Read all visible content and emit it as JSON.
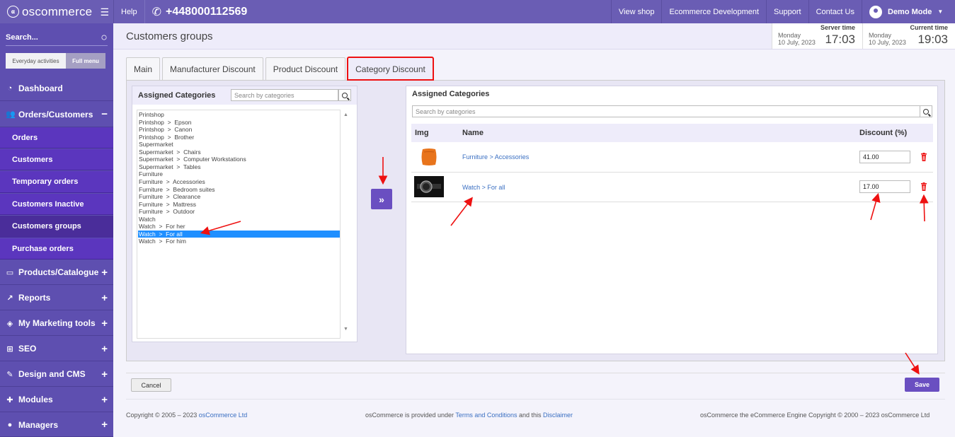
{
  "topbar": {
    "logo_text": "oscommerce",
    "logo_mark": "⍺",
    "menu_icon": "hamburger-icon",
    "help_label": "Help",
    "phone": "+448000112569",
    "links": [
      "View shop",
      "Ecommerce Development",
      "Support",
      "Contact Us"
    ],
    "user_label": "Demo Mode"
  },
  "sidebar": {
    "search_placeholder": "Search...",
    "mode_everyday": "Everyday activities",
    "mode_full": "Full menu",
    "dashboard": "Dashboard",
    "orders_customers": "Orders/Customers",
    "subitems": [
      "Orders",
      "Customers",
      "Temporary orders",
      "Customers Inactive",
      "Customers groups",
      "Purchase orders"
    ],
    "sections": [
      "Products/Catalogue",
      "Reports",
      "My Marketing tools",
      "SEO",
      "Design and CMS",
      "Modules",
      "Managers"
    ]
  },
  "header": {
    "page_title": "Customers groups",
    "server_time_label": "Server time",
    "server_day": "Monday",
    "server_date": "10 July, 2023",
    "server_clock": "17:03",
    "current_time_label": "Current time",
    "current_day": "Monday",
    "current_date": "10 July, 2023",
    "current_clock": "19:03"
  },
  "tabs": [
    "Main",
    "Manufacturer Discount",
    "Product Discount",
    "Category Discount"
  ],
  "left_panel": {
    "title": "Assigned Categories",
    "search_placeholder": "Search by categories",
    "categories": [
      "Printshop",
      "Printshop  >  Epson",
      "Printshop  >  Canon",
      "Printshop  >  Brother",
      "Supermarket",
      "Supermarket  >  Chairs",
      "Supermarket  >  Computer Workstations",
      "Supermarket  >  Tables",
      "Furniture",
      "Furniture  >  Accessories",
      "Furniture  >  Bedroom suites",
      "Furniture  >  Clearance",
      "Furniture  >  Mattress",
      "Furniture  >  Outdoor",
      "Watch",
      "Watch  >  For her",
      "Watch  >  For all",
      "Watch  >  For him"
    ],
    "selected_index": 16
  },
  "move_button_glyph": "»",
  "right_panel": {
    "title": "Assigned Categories",
    "search_placeholder": "Search by categories",
    "columns": [
      "Img",
      "Name",
      "Discount (%)"
    ],
    "rows": [
      {
        "name": "Furniture > Accessories",
        "discount": "41.00"
      },
      {
        "name": "Watch > For all",
        "discount": "17.00"
      }
    ]
  },
  "actions": {
    "cancel_label": "Cancel",
    "save_label": "Save"
  },
  "footer": {
    "copyright_prefix": "Copyright © 2005 – 2023 ",
    "copyright_link": "osCommerce Ltd",
    "provided_prefix": "osCommerce is provided under ",
    "terms_link": "Terms and Conditions",
    "provided_mid": " and this ",
    "disclaimer_link": "Disclaimer",
    "engine_text": "osCommerce the eCommerce Engine Copyright © 2000 – 2023 osCommerce Ltd"
  },
  "colors": {
    "brand": "#6a5db4",
    "accent": "#6a4fc1",
    "highlight": "#e11111",
    "selection": "#1f8fff"
  }
}
